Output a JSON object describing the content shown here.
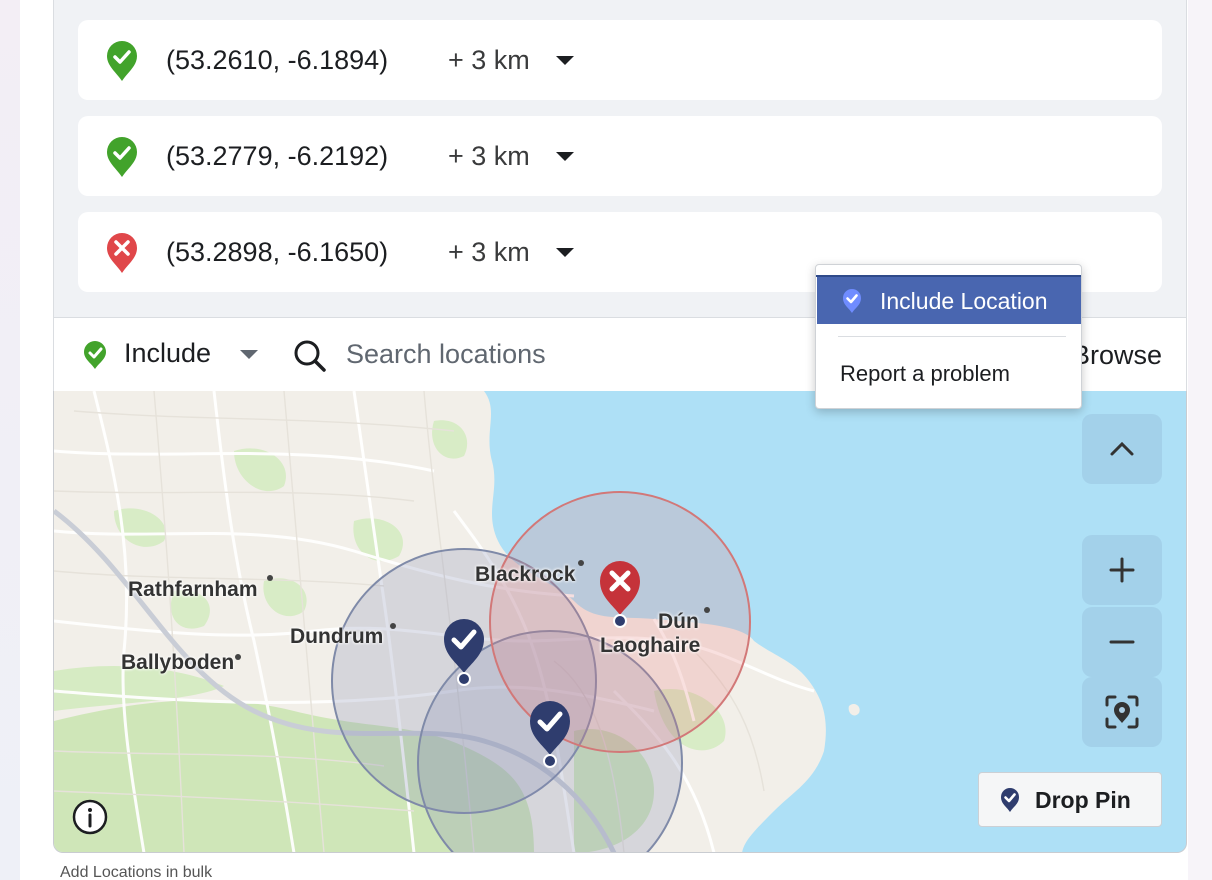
{
  "locations": [
    {
      "coords": "(53.2610, -6.1894)",
      "radius": "+ 3 km",
      "status": "include"
    },
    {
      "coords": "(53.2779, -6.2192)",
      "radius": "+ 3 km",
      "status": "include"
    },
    {
      "coords": "(53.2898, -6.1650)",
      "radius": "+ 3 km",
      "status": "exclude"
    }
  ],
  "toolbar": {
    "mode_label": "Include",
    "search_placeholder": "Search locations",
    "browse_label": "Browse"
  },
  "context_menu": {
    "include_label": "Include Location",
    "report_label": "Report a problem"
  },
  "map": {
    "labels": {
      "rathfarnham": "Rathfarnham",
      "dundrum": "Dundrum",
      "ballyboden": "Ballyboden",
      "blackrock": "Blackrock",
      "dun": "Dún",
      "laoghaire": "Laoghaire"
    },
    "drop_pin_label": "Drop Pin"
  },
  "colors": {
    "include_green": "#42a32b",
    "exclude_red": "#e0474a",
    "pin_navy": "#2f3d6e",
    "menu_selected": "#4966b0"
  },
  "footer": {
    "text": "Add Locations in bulk"
  }
}
